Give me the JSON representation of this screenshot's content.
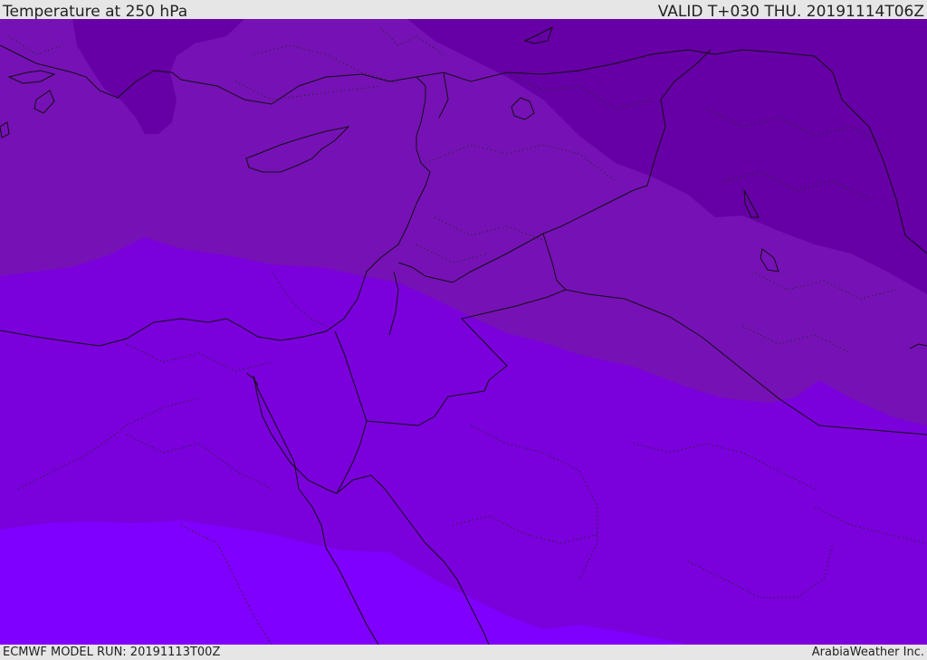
{
  "header": {
    "title": "Temperature at 250 hPa",
    "valid": "VALID T+030 THU. 20191114T06Z"
  },
  "footer": {
    "model_run": "ECMWF MODEL RUN: 20191113T00Z",
    "credit": "ArabiaWeather Inc."
  },
  "map": {
    "field": "temperature",
    "level": "250 hPa",
    "region": "Eastern Mediterranean and Middle East",
    "colors": {
      "band_coldest": "#6600a6",
      "band_cold": "#7611b6",
      "band_mid": "#7a00dc",
      "band_warm": "#8000ff",
      "coastline": "#111111",
      "border": "#111111",
      "province_border": "#333333"
    }
  }
}
